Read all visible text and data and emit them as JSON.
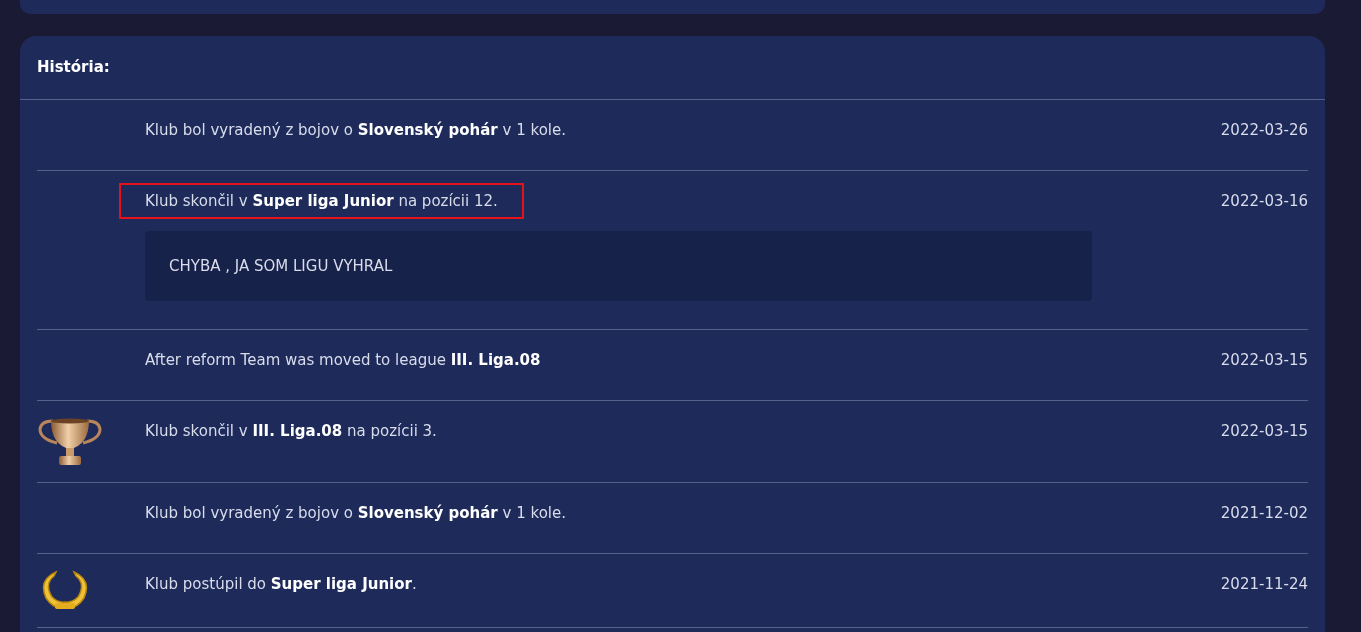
{
  "title": "História:",
  "events": [
    {
      "kind": "plain",
      "text": "Klub bol vyradený z bojov o **Slovenský pohár** v 1 kole.",
      "date": "2022-03-26",
      "highlighted": false
    },
    {
      "kind": "plain",
      "text": "Klub skončil v **Super liga Junior** na pozícii 12.",
      "date": "2022-03-16",
      "highlighted": true,
      "note": "CHYBA , JA SOM LIGU VYHRAL"
    },
    {
      "kind": "plain",
      "text": "After reform Team was moved to league **III. Liga.08**",
      "date": "2022-03-15",
      "highlighted": false
    },
    {
      "kind": "trophy",
      "text": "Klub skončil v **III. Liga.08** na pozícii 3.",
      "date": "2022-03-15",
      "highlighted": false
    },
    {
      "kind": "plain",
      "text": "Klub bol vyradený z bojov o **Slovenský pohár** v 1 kole.",
      "date": "2021-12-02",
      "highlighted": false
    },
    {
      "kind": "wreath",
      "text": "Klub postúpil do **Super liga Junior**.",
      "date": "2021-11-24",
      "highlighted": false
    }
  ]
}
